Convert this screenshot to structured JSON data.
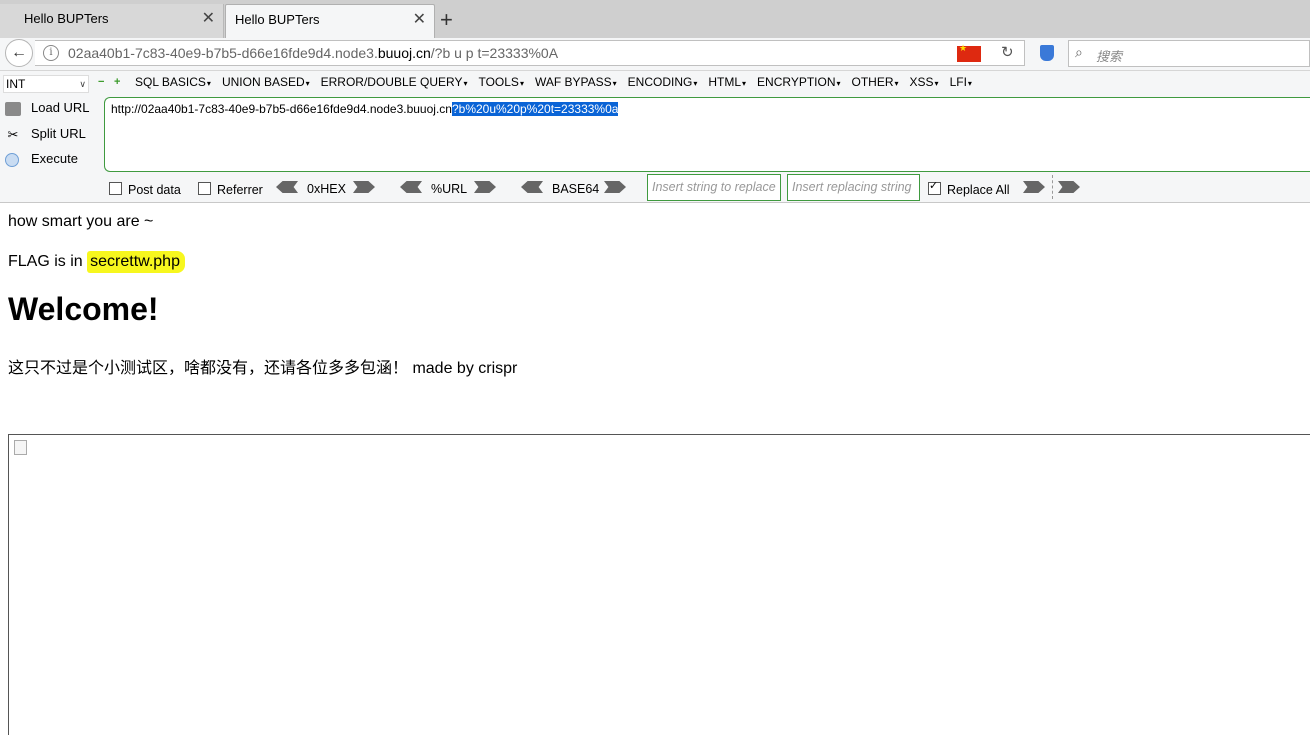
{
  "tabs": [
    {
      "title": "Hello BUPTers",
      "close": "✕"
    },
    {
      "title": "Hello BUPTers",
      "close": "✕"
    }
  ],
  "new_tab": "+",
  "address": {
    "prefix": "02aa40b1-7c83-40e9-b7b5-d66e16fde9d4.node3.",
    "host": "buuoj.cn",
    "path": "/?b u p t=23333%0A"
  },
  "search": {
    "placeholder": "搜索"
  },
  "hackbar": {
    "type_select": "INT",
    "menu": [
      "SQL BASICS",
      "UNION BASED",
      "ERROR/DOUBLE QUERY",
      "TOOLS",
      "WAF BYPASS",
      "ENCODING",
      "HTML",
      "ENCRYPTION",
      "OTHER",
      "XSS",
      "LFI"
    ],
    "load_url": "Load URL",
    "split_url": "Split URL",
    "execute": "Execute",
    "url_plain": "http://02aa40b1-7c83-40e9-b7b5-d66e16fde9d4.node3.buuoj.cn",
    "url_selected": "?b%20u%20p%20t=23333%0a",
    "post_data": "Post data",
    "referrer": "Referrer",
    "hex": "0xHEX",
    "url_enc": "%URL",
    "base64": "BASE64",
    "insert_placeholder": "Insert string to replace",
    "replacing_placeholder": "Insert replacing string",
    "replace_all": "Replace All"
  },
  "page": {
    "line1": "how smart you are ~",
    "flag_prefix": "FLAG is in ",
    "flag_file": "secrettw.php",
    "heading": "Welcome!",
    "notice": "这只不过是个小测试区，啥都没有，还请各位多多包涵！ made by crispr"
  }
}
